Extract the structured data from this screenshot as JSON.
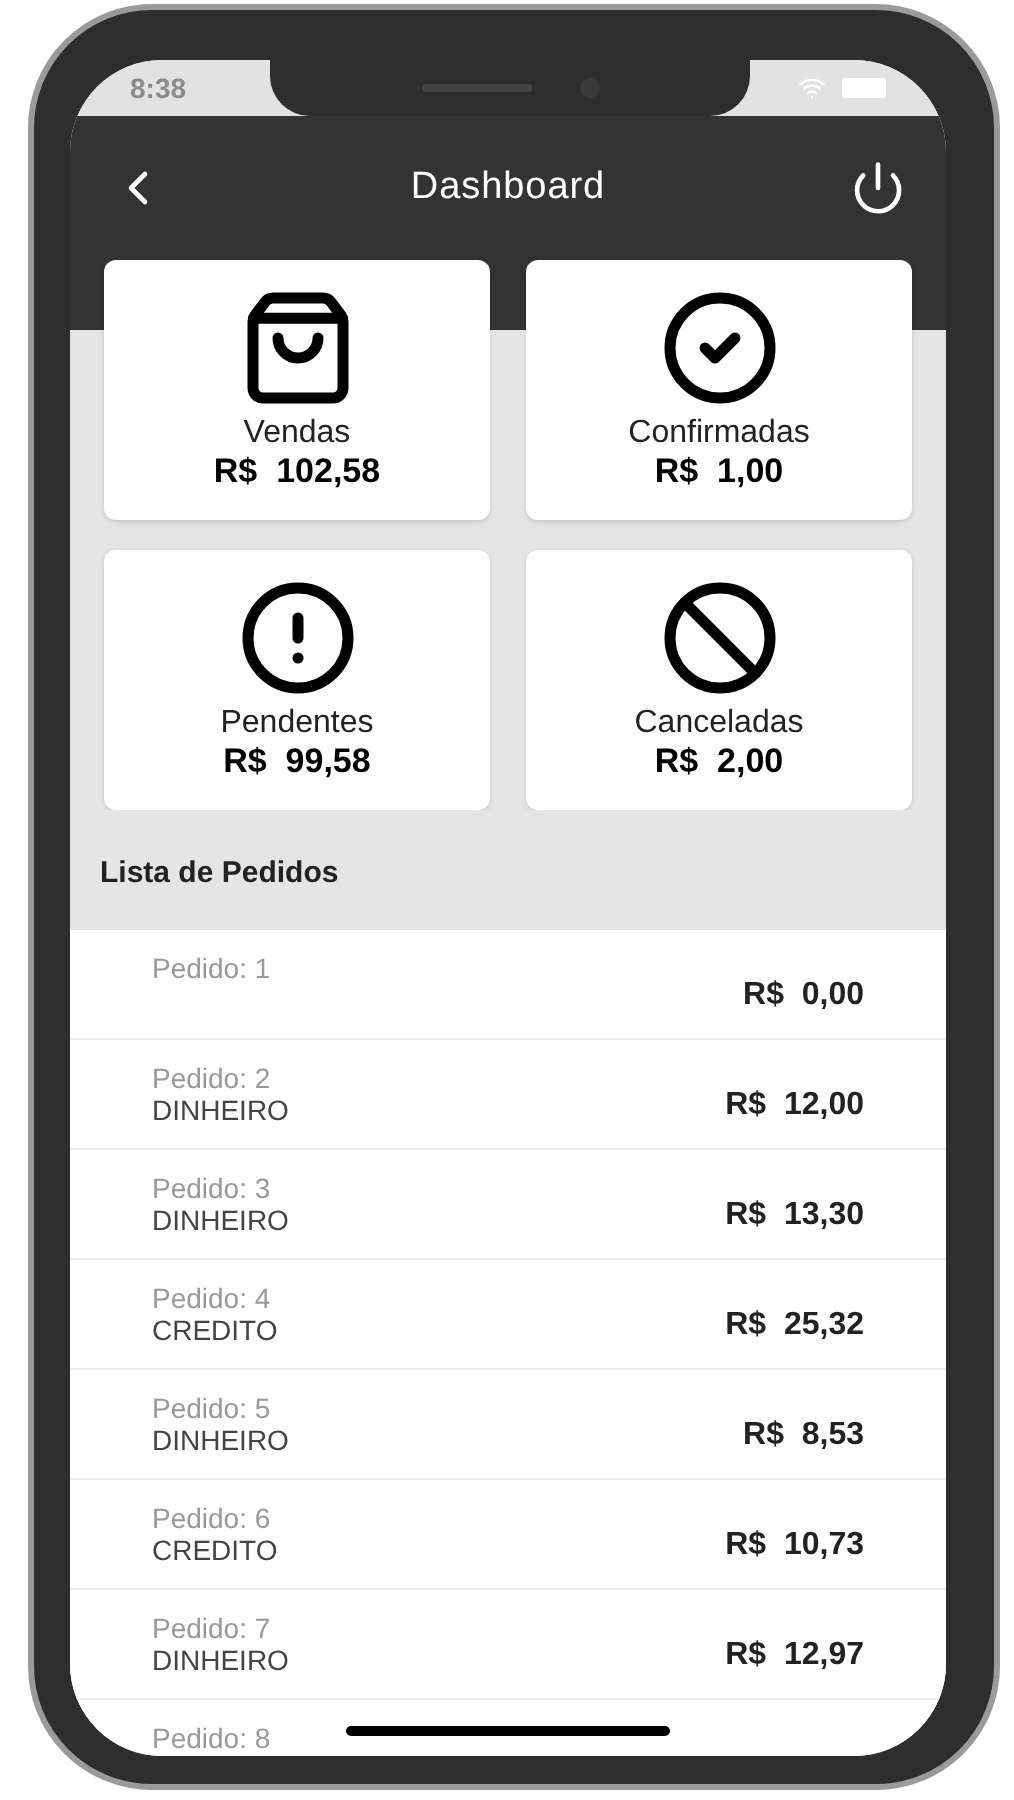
{
  "status_bar": {
    "time": "8:38"
  },
  "header": {
    "title": "Dashboard"
  },
  "cards": [
    {
      "kind": "bag",
      "label": "Vendas",
      "value": "R$  102,58"
    },
    {
      "kind": "check",
      "label": "Confirmadas",
      "value": "R$  1,00"
    },
    {
      "kind": "alert",
      "label": "Pendentes",
      "value": "R$  99,58"
    },
    {
      "kind": "ban",
      "label": "Canceladas",
      "value": "R$  2,00"
    }
  ],
  "list": {
    "title": "Lista de Pedidos",
    "orders": [
      {
        "label": "Pedido: 1",
        "amount": "R$  0,00"
      },
      {
        "label": "Pedido: 2",
        "payment": "DINHEIRO",
        "amount": "R$  12,00"
      },
      {
        "label": "Pedido: 3",
        "payment": "DINHEIRO",
        "amount": "R$  13,30"
      },
      {
        "label": "Pedido: 4",
        "payment": "CREDITO",
        "amount": "R$  25,32"
      },
      {
        "label": "Pedido: 5",
        "payment": "DINHEIRO",
        "amount": "R$  8,53"
      },
      {
        "label": "Pedido: 6",
        "payment": "CREDITO",
        "amount": "R$  10,73"
      },
      {
        "label": "Pedido: 7",
        "payment": "DINHEIRO",
        "amount": "R$  12,97"
      },
      {
        "label": "Pedido: 8"
      }
    ]
  }
}
